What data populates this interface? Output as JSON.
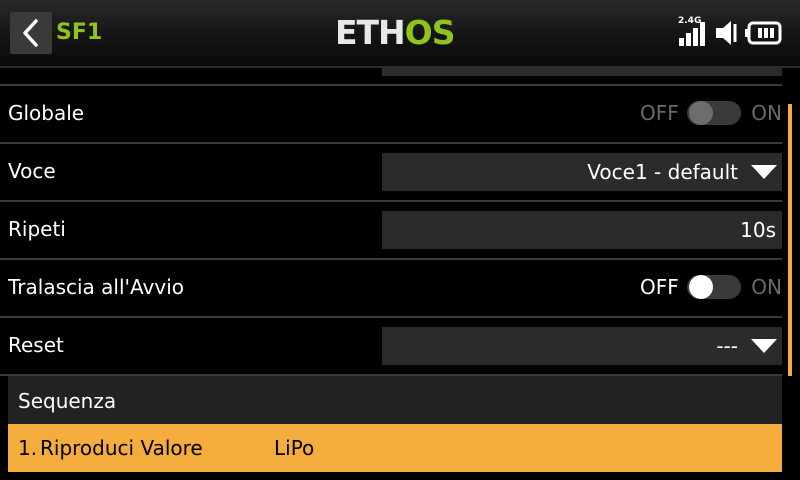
{
  "header": {
    "title": "SF1",
    "brand_part1": "ETH",
    "brand_part2": "OS",
    "signal_label": "2.4G"
  },
  "colors": {
    "accent_green": "#8fc31f",
    "highlight_orange": "#f4ac3c",
    "field_bg": "#2b2b2b"
  },
  "rows": {
    "globale": {
      "label": "Globale",
      "off": "OFF",
      "on": "ON",
      "state": "off",
      "enabled": false
    },
    "voce": {
      "label": "Voce",
      "value": "Voce1 - default"
    },
    "ripeti": {
      "label": "Ripeti",
      "value": "10s"
    },
    "tralascia": {
      "label": "Tralascia all'Avvio",
      "off": "OFF",
      "on": "ON",
      "state": "off",
      "enabled": true
    },
    "reset": {
      "label": "Reset",
      "value": "---"
    }
  },
  "sequence": {
    "title": "Sequenza",
    "items": [
      {
        "number": "1.",
        "action": "Riproduci Valore",
        "value": "LiPo"
      }
    ]
  }
}
